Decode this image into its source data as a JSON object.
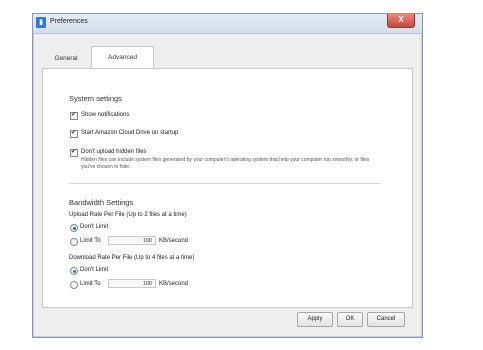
{
  "window": {
    "title": "Preferences",
    "close_label": "X"
  },
  "tabs": [
    {
      "label": "General",
      "active": false
    },
    {
      "label": "Advanced",
      "active": true
    }
  ],
  "system_settings": {
    "heading": "System settings",
    "show_notifications": {
      "label": "Show notifications",
      "checked": true
    },
    "start_on_startup": {
      "label": "Start Amazon Cloud Drive on startup",
      "checked": true
    },
    "hidden_files": {
      "label": "Don't upload hidden files",
      "checked": true,
      "hint": "Hidden files can include system files generated by your computer's operating system that help your computer run smoothly, or files you've chosen to hide."
    }
  },
  "bandwidth": {
    "heading": "Bandwidth Settings",
    "upload": {
      "label": "Upload Rate Per File (Up to 2 files at a time)",
      "dont_limit": "Don't Limit",
      "limit_to": "Limit To",
      "value": "100",
      "unit": "KB/second",
      "selected": "dont_limit"
    },
    "download": {
      "label": "Download Rate Per File (Up to 4 files at a time)",
      "dont_limit": "Don't Limit",
      "limit_to": "Limit To",
      "value": "100",
      "unit": "KB/second",
      "selected": "dont_limit"
    }
  },
  "buttons": {
    "apply": "Apply",
    "ok": "OK",
    "cancel": "Cancel"
  }
}
